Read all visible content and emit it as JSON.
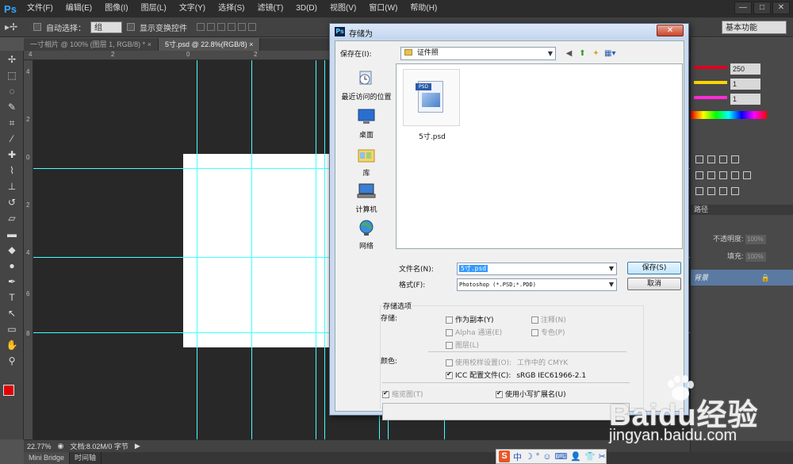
{
  "app": {
    "logo": "Ps",
    "menu": [
      "文件(F)",
      "编辑(E)",
      "图像(I)",
      "图层(L)",
      "文字(Y)",
      "选择(S)",
      "滤镜(T)",
      "3D(D)",
      "视图(V)",
      "窗口(W)",
      "帮助(H)"
    ],
    "window_controls": [
      "—",
      "□",
      "✕"
    ]
  },
  "options_bar": {
    "auto_select_label": "自动选择：",
    "auto_select_value": "组",
    "show_transform_label": "显示变换控件",
    "workspace": "基本功能"
  },
  "doc_tabs": [
    {
      "label": "一寸相片 @ 100% (图层 1, RGB/8) *",
      "close": "×"
    },
    {
      "label": "5寸.psd @ 22.8%(RGB/8)",
      "close": "×"
    }
  ],
  "rulers": {
    "top": [
      "4",
      "2",
      "0",
      "2",
      "4",
      "6"
    ],
    "left": [
      "4",
      "2",
      "0",
      "2",
      "4",
      "6",
      "8"
    ]
  },
  "status": {
    "zoom": "22.77%",
    "doc_size": "文档:8.02M/0 字节"
  },
  "bottom_tabs": [
    "Mini Bridge",
    "时间轴"
  ],
  "color_panel": {
    "values": [
      "250",
      "1",
      "1"
    ],
    "colors": {
      "r": "#e0001f",
      "g": "#ffd400",
      "b": "#ff2bd6"
    }
  },
  "layers_panel": {
    "tab": "路径",
    "opacity_label": "不透明度:",
    "opacity_value": "100%",
    "fill_label": "填充:",
    "fill_value": "100%",
    "layer_name": "背景"
  },
  "watermark": {
    "brand": "Baidu经验",
    "url": "jingyan.baidu.com"
  },
  "ime": {
    "logo": "S",
    "mode": "中"
  },
  "dialog": {
    "title": "存储为",
    "close": "✕",
    "save_in_label": "保存在(I):",
    "save_in_value": "证件照",
    "places": [
      "最近访问的位置",
      "桌面",
      "库",
      "计算机",
      "网络"
    ],
    "files": [
      {
        "name": "5寸.psd",
        "badge": "PSD"
      }
    ],
    "filename_label": "文件名(N):",
    "filename_value": "5寸.psd",
    "format_label": "格式(F):",
    "format_value": "Photoshop (*.PSD;*.PDD)",
    "save_button": "保存(S)",
    "cancel_button": "取消",
    "options_title": "存储选项",
    "storage_label": "存储:",
    "opt_copy": "作为副本(Y)",
    "opt_annotation": "注释(N)",
    "opt_alpha": "Alpha 通道(E)",
    "opt_spot": "专色(P)",
    "opt_layers": "图层(L)",
    "color_label": "颜色:",
    "opt_proof": "使用校样设置(O):",
    "opt_proof_value": "工作中的 CMYK",
    "opt_icc": "ICC 配置文件(C):",
    "opt_icc_value": "sRGB IEC61966-2.1",
    "opt_thumb": "缩览图(T)",
    "opt_lowercase": "使用小写扩展名(U)"
  }
}
